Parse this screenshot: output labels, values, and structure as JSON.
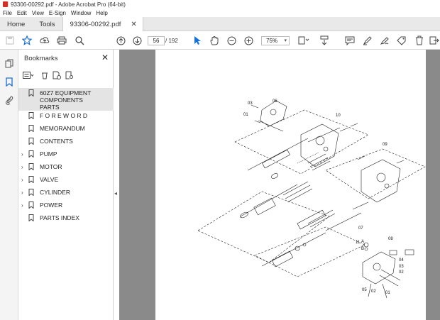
{
  "window": {
    "title": "93306-00292.pdf - Adobe Acrobat Pro (64-bit)"
  },
  "menu": [
    "File",
    "Edit",
    "View",
    "E-Sign",
    "Window",
    "Help"
  ],
  "tabs": {
    "home": "Home",
    "tools": "Tools",
    "document": "93306-00292.pdf"
  },
  "toolbar": {
    "page_current": "56",
    "page_total": "/ 192",
    "zoom": "75%"
  },
  "bookmarks": {
    "title": "Bookmarks",
    "items": [
      {
        "label": "60Z7 EQUIPMENT COMPONENTS PARTS",
        "expandable": false,
        "selected": true
      },
      {
        "label": "F O R E W O R D",
        "expandable": false
      },
      {
        "label": "MEMORANDUM",
        "expandable": false
      },
      {
        "label": "CONTENTS",
        "expandable": false
      },
      {
        "label": "PUMP",
        "expandable": true
      },
      {
        "label": "MOTOR",
        "expandable": true
      },
      {
        "label": "VALVE",
        "expandable": true
      },
      {
        "label": "CYLINDER",
        "expandable": true
      },
      {
        "label": "POWER",
        "expandable": true
      },
      {
        "label": "PARTS INDEX",
        "expandable": false
      }
    ]
  },
  "drawing": {
    "callouts": [
      "03",
      "06",
      "01",
      "10",
      "09",
      "07",
      "08",
      "11",
      "A",
      "B",
      "04",
      "03",
      "02",
      "05",
      "02",
      "01"
    ]
  },
  "colors": {
    "accent": "#1a6fd6",
    "pdf_red": "#d42f24",
    "doc_bg": "#8a8a8a"
  }
}
